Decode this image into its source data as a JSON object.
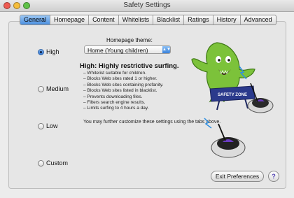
{
  "window": {
    "title": "Safety Settings"
  },
  "tabs": [
    {
      "label": "General",
      "active": true
    },
    {
      "label": "Homepage",
      "active": false
    },
    {
      "label": "Content",
      "active": false
    },
    {
      "label": "Whitelists",
      "active": false
    },
    {
      "label": "Blacklist",
      "active": false
    },
    {
      "label": "Ratings",
      "active": false
    },
    {
      "label": "History",
      "active": false
    },
    {
      "label": "Advanced",
      "active": false
    }
  ],
  "levels": [
    {
      "label": "High",
      "selected": true
    },
    {
      "label": "Medium",
      "selected": false
    },
    {
      "label": "Low",
      "selected": false
    },
    {
      "label": "Custom",
      "selected": false
    }
  ],
  "theme": {
    "label": "Homepage theme:",
    "selected": "Home (Young children)"
  },
  "summary": {
    "heading": "High: Highly restrictive surfing.",
    "bullets": [
      "– Whitelist suitable for children.",
      "– Blocks Web sites rated 1 or higher.",
      "– Blocks Web sites containing profanity.",
      "– Blocks Web sites listed in blacklist.",
      "– Prevents downloading files.",
      "– Filters search engine results.",
      "– Limits surfing to 4 hours a day."
    ],
    "note": "You may further customize these settings using the tabs above."
  },
  "illustration": {
    "sign_text": "SAFETY ZONE"
  },
  "buttons": {
    "exit": "Exit Preferences",
    "help": "?"
  },
  "colors": {
    "accent": "#3a82db",
    "monster": "#7cc23a",
    "sign": "#2b3a8c"
  }
}
